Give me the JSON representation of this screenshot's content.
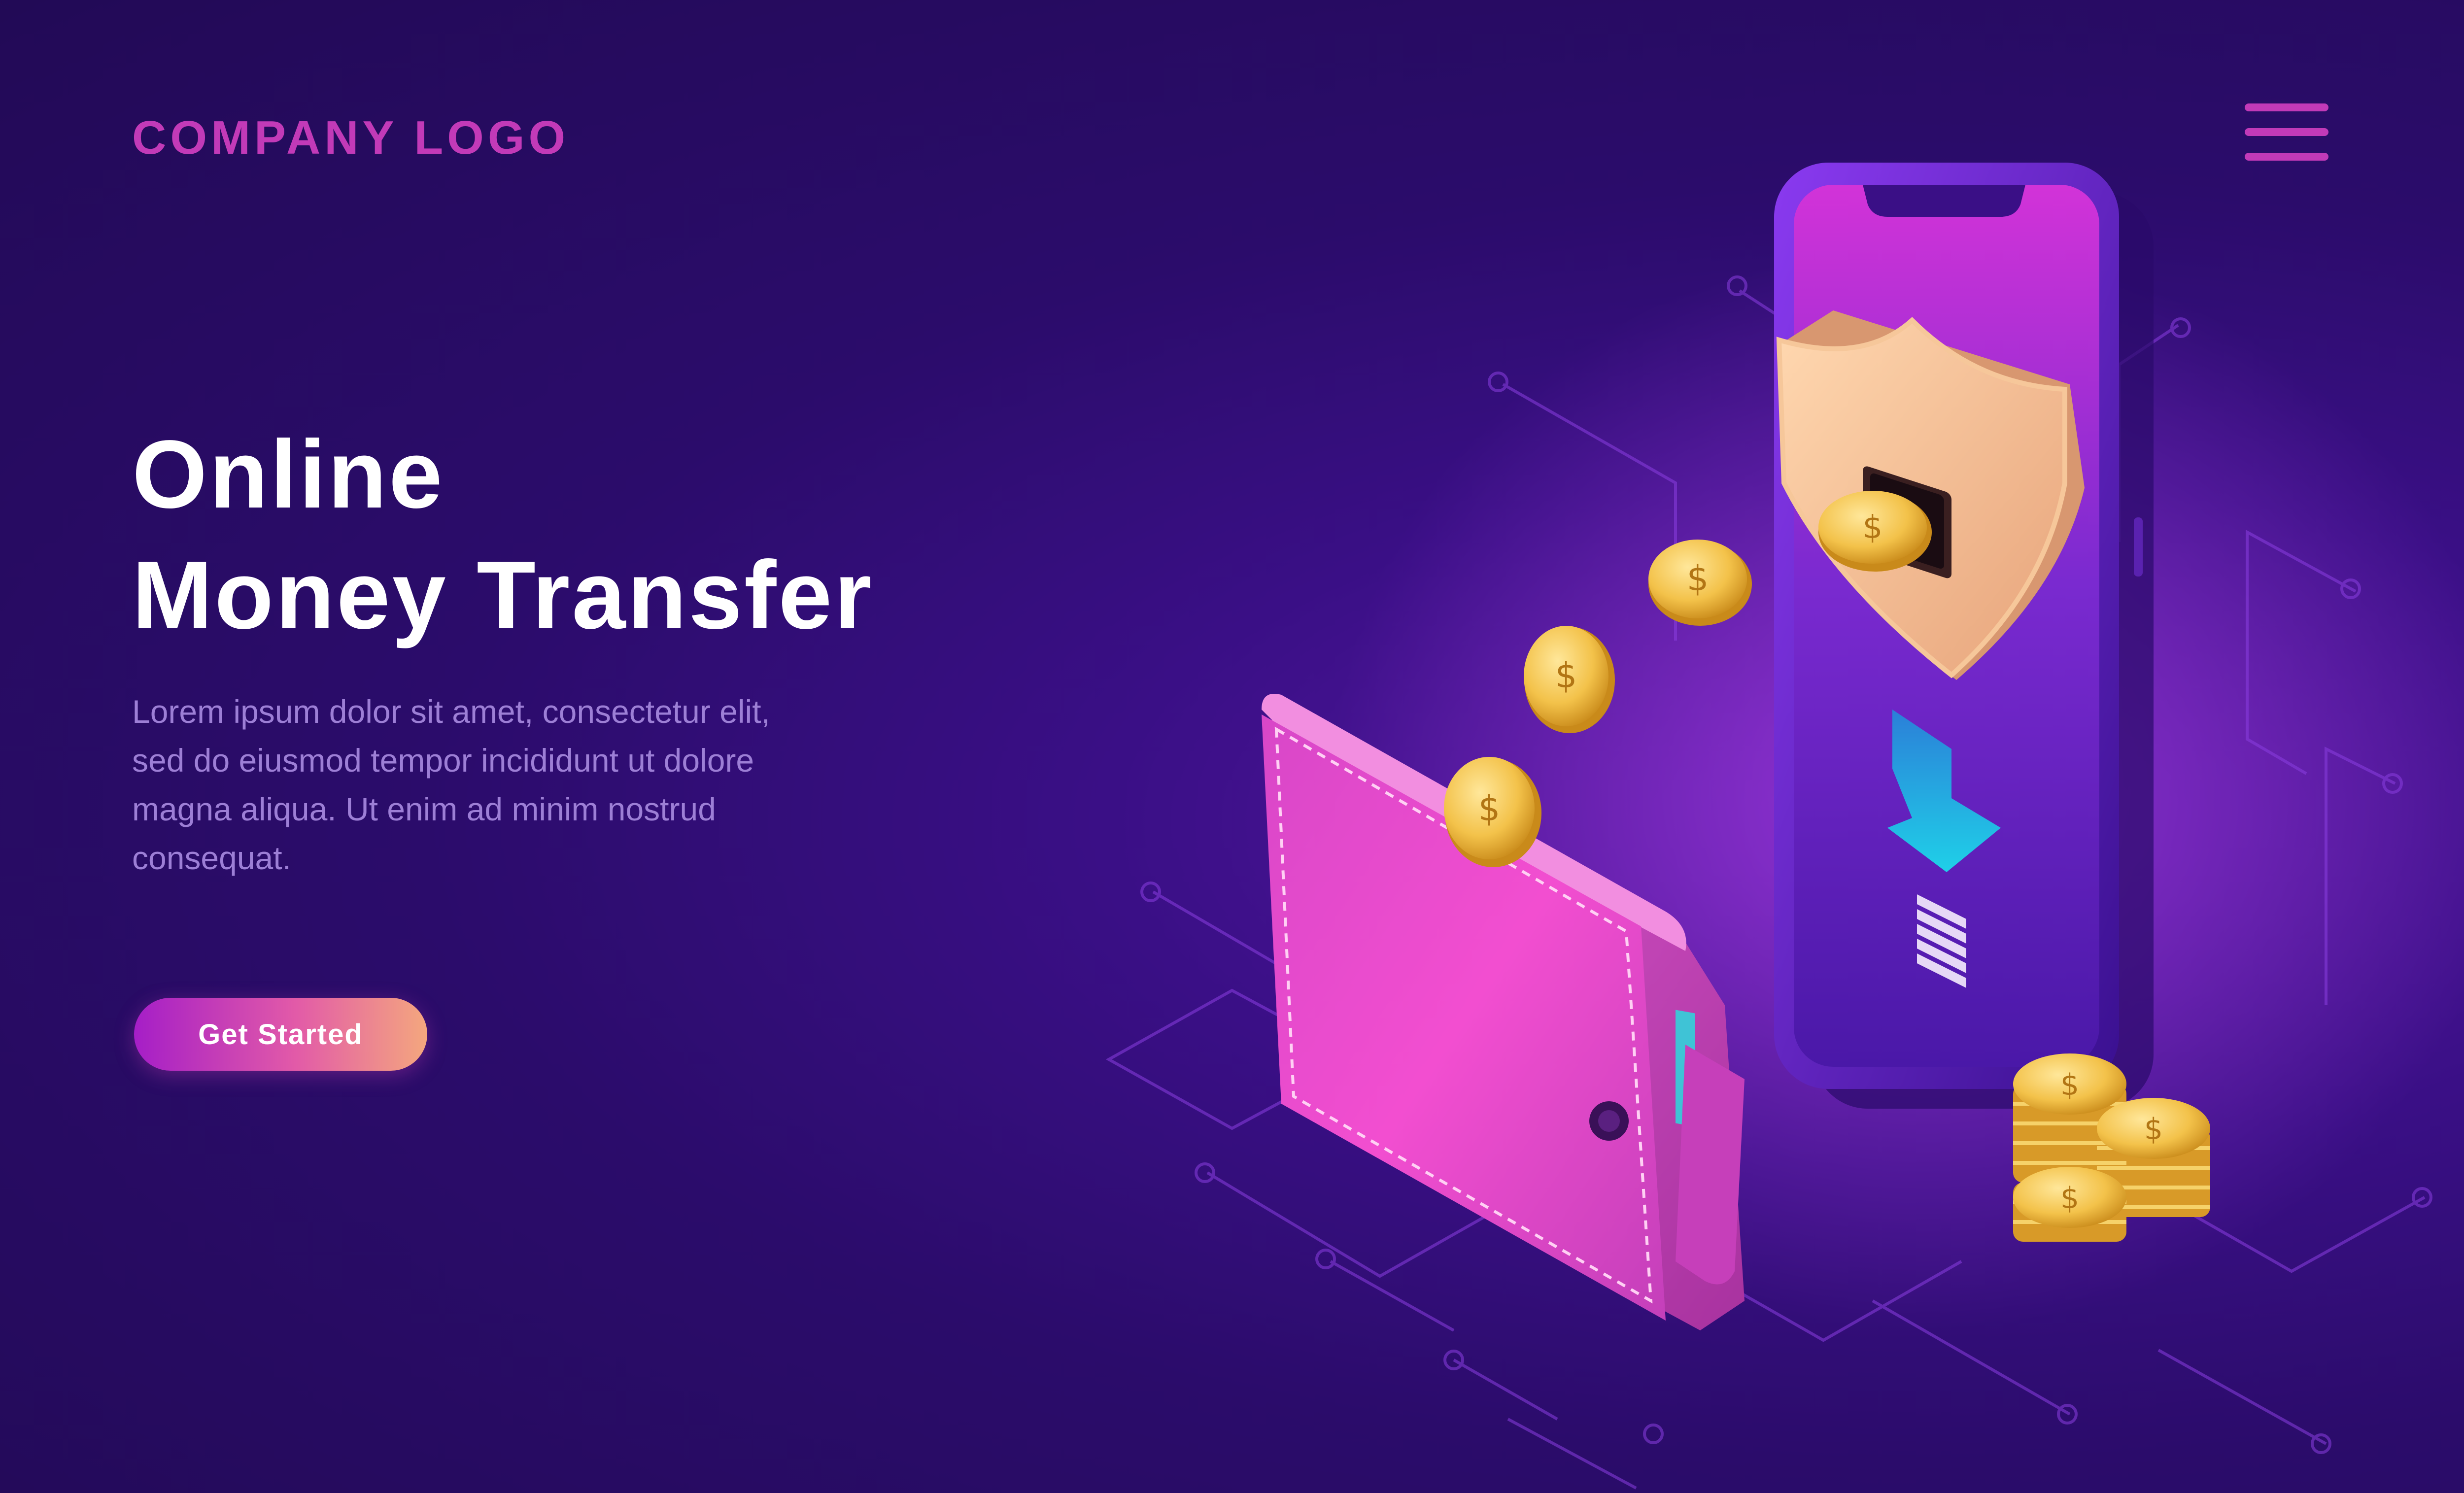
{
  "header": {
    "logo": "COMPANY LOGO",
    "menu_icon": "hamburger-menu-icon"
  },
  "hero": {
    "title_line1": "Online",
    "title_line2": "Money Transfer",
    "description": "Lorem ipsum dolor sit amet, consectetur elit, sed do eiusmod tempor incididunt ut dolore magna aliqua. Ut enim ad minim nostrud consequat.",
    "cta_label": "Get Started"
  },
  "illustration": {
    "icons": [
      "smartphone-icon",
      "security-shield-icon",
      "download-arrow-icon",
      "coin-stack-icon",
      "wallet-icon",
      "gold-coin-icon"
    ]
  },
  "colors": {
    "background": "#2b0c6b",
    "accent": "#c23ab8",
    "arrow": "#1fb8e0",
    "coin": "#f2c04a",
    "wallet": "#e24cc4"
  }
}
